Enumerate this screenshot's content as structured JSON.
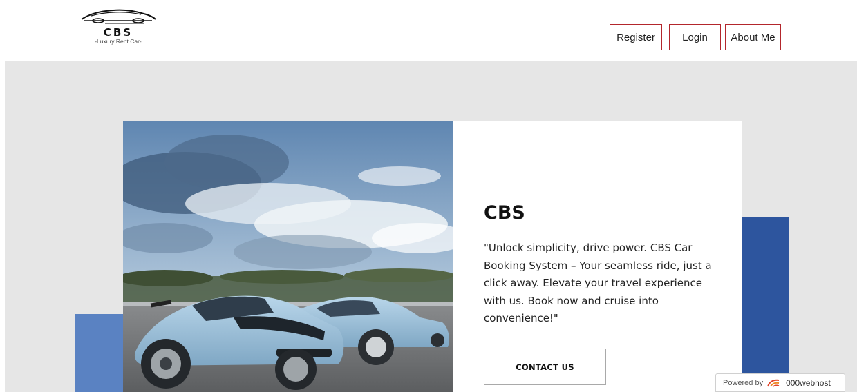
{
  "brand": {
    "name": "CBS",
    "tagline": "-Luxury Rent Car-"
  },
  "nav": {
    "register": "Register",
    "login": "Login",
    "about": "About Me"
  },
  "hero": {
    "title": "CBS",
    "text": "\"Unlock simplicity, drive power. CBS Car Booking System – Your seamless ride, just a click away. Elevate your travel experience with us. Book now and cruise into convenience!\"",
    "cta": "CONTACT US"
  },
  "footer_badge": {
    "prefix": "Powered by",
    "brand": "000webhost"
  },
  "colors": {
    "nav_border": "#b3262c",
    "hero_bg": "#e6e6e6",
    "accent_light": "#5a82c2",
    "accent_dark": "#2d559e"
  }
}
